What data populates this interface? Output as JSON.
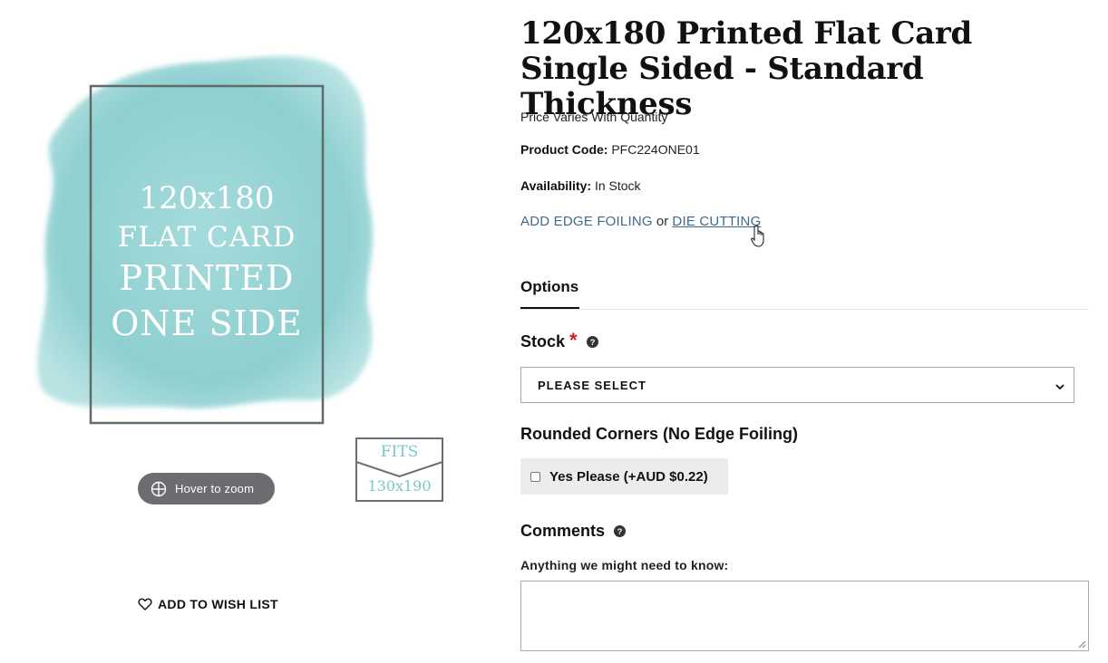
{
  "product": {
    "title": "120x180 Printed Flat Card Single Sided - Standard Thickness",
    "price_note": "Price Varies With Quantity",
    "code_label": "Product Code:",
    "code_value": "PFC224ONE01",
    "availability_label": "Availability:",
    "availability_value": "In Stock",
    "links": {
      "edge_foiling": "ADD EDGE FOILING",
      "or": "or",
      "die_cutting": "DIE CUTTING"
    }
  },
  "gallery": {
    "image_text": [
      "120x180",
      "FLAT CARD",
      "PRINTED",
      "ONE SIDE"
    ],
    "zoom_label": "Hover to zoom",
    "fits_badge": [
      "FITS",
      "130x190"
    ],
    "wishlist_label": "ADD TO WISH LIST"
  },
  "options": {
    "tab_label": "Options",
    "stock": {
      "label": "Stock",
      "required_mark": "*",
      "selected": "PLEASE SELECT"
    },
    "rounded_corners": {
      "label": "Rounded Corners (No Edge Foiling)",
      "checkbox_label": "Yes Please (+AUD $0.22)",
      "checked": false
    },
    "comments": {
      "label": "Comments",
      "hint": "Anything we might need to know:",
      "value": ""
    }
  },
  "colors": {
    "watercolor": "#8ecfd0",
    "link": "#3e6a8e",
    "required": "#d41f1f",
    "zoom_pill": "#6b6d70"
  },
  "icons": [
    "crosshair-globe-icon",
    "heart-icon",
    "help-icon",
    "chevron-down-icon",
    "hand-cursor-icon"
  ]
}
